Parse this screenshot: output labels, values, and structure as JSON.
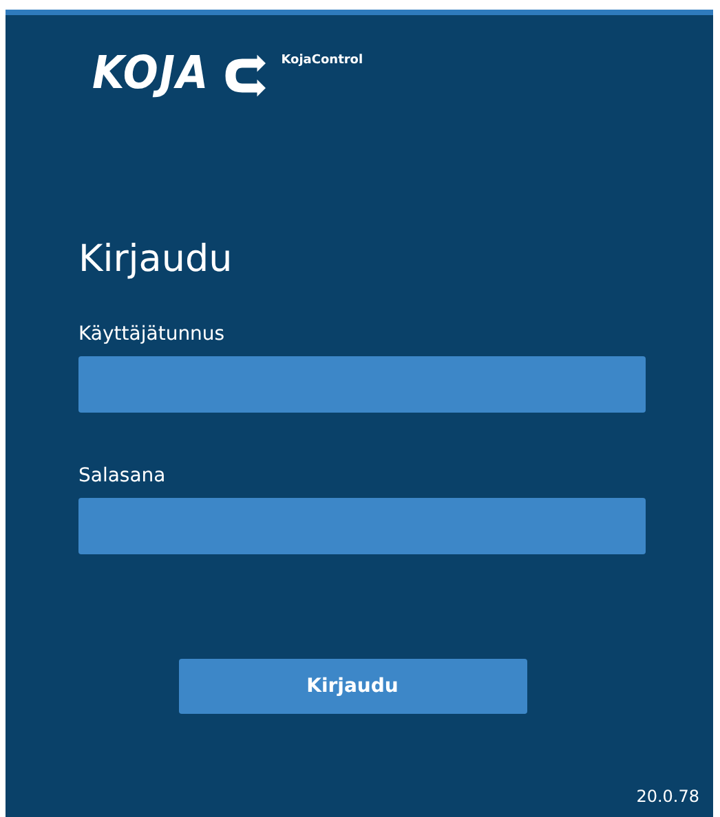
{
  "logo": {
    "wordmark": "KOJA",
    "product": "KojaControl"
  },
  "title": "Kirjaudu",
  "fields": [
    {
      "label": "Käyttäjätunnus"
    },
    {
      "label": "Salasana"
    }
  ],
  "submit": "Kirjaudu",
  "version": "20.0.78"
}
